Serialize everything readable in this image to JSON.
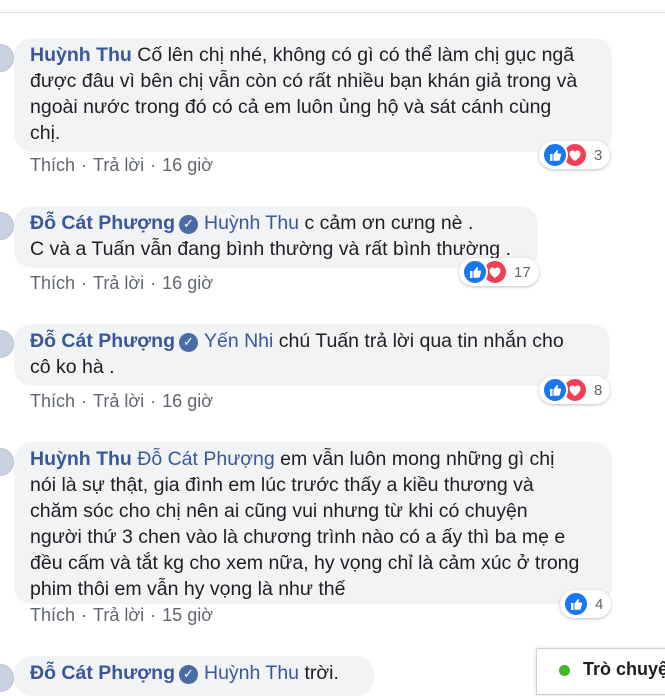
{
  "comments": [
    {
      "author": "Huỳnh Thu",
      "verified": false,
      "mention": "",
      "lines": [
        "Cố lên chị nhé, không có gì có thể làm chị gục ngã",
        "được đâu vì bên chị vẫn còn có rất nhiều bạn khán giả trong và",
        "ngoài nước trong đó có cả em luôn ủng hộ và sát cánh cùng",
        "chị."
      ],
      "like_label": "Thích",
      "reply_label": "Trả lời",
      "time": "16 giờ",
      "reaction_icons": [
        "like-icon",
        "love-icon"
      ],
      "reaction_count": "3"
    },
    {
      "author": "Đỗ Cát Phượng",
      "verified": true,
      "mention": "Huỳnh Thu",
      "lines": [
        "c cảm ơn cưng nè .",
        "C và a Tuấn vẫn đang bình thường và rất bình thường ."
      ],
      "like_label": "Thích",
      "reply_label": "Trả lời",
      "time": "16 giờ",
      "reaction_icons": [
        "like-icon",
        "love-icon"
      ],
      "reaction_count": "17"
    },
    {
      "author": "Đỗ Cát Phượng",
      "verified": true,
      "mention": "Yến Nhi",
      "lines": [
        "chú Tuấn trả lời qua tin nhắn cho",
        "cô ko hà ."
      ],
      "like_label": "Thích",
      "reply_label": "Trả lời",
      "time": "16 giờ",
      "reaction_icons": [
        "like-icon",
        "love-icon"
      ],
      "reaction_count": "8"
    },
    {
      "author": "Huỳnh Thu",
      "verified": false,
      "mention": "Đỗ Cát Phượng",
      "lines": [
        "em vẫn luôn mong những gì chị",
        "nói là sự thật, gia đình em lúc trước thấy a kiều thương và",
        "chăm sóc cho chị nên ai cũng vui nhưng từ khi có chuyện",
        "người thứ 3 chen vào là chương trình nào có a ấy thì ba mẹ e",
        "đều cấm và tắt kg cho xem nữa, hy vọng chỉ là cảm xúc ở trong",
        "phim thôi em vẫn hy vọng là như thế"
      ],
      "like_label": "Thích",
      "reply_label": "Trả lời",
      "time": "15 giờ",
      "reaction_icons": [
        "like-icon"
      ],
      "reaction_count": "4"
    },
    {
      "author": "Đỗ Cát Phượng",
      "verified": true,
      "mention": "Huỳnh Thu",
      "lines": [
        "trời."
      ]
    }
  ],
  "chat": {
    "label": "Trò chuyện",
    "status_color": "#42b72a"
  },
  "colors": {
    "author": "#385898",
    "bubble": "#f2f3f5",
    "meta": "#606770",
    "like": "#1877f2",
    "love": "#f33e58"
  }
}
